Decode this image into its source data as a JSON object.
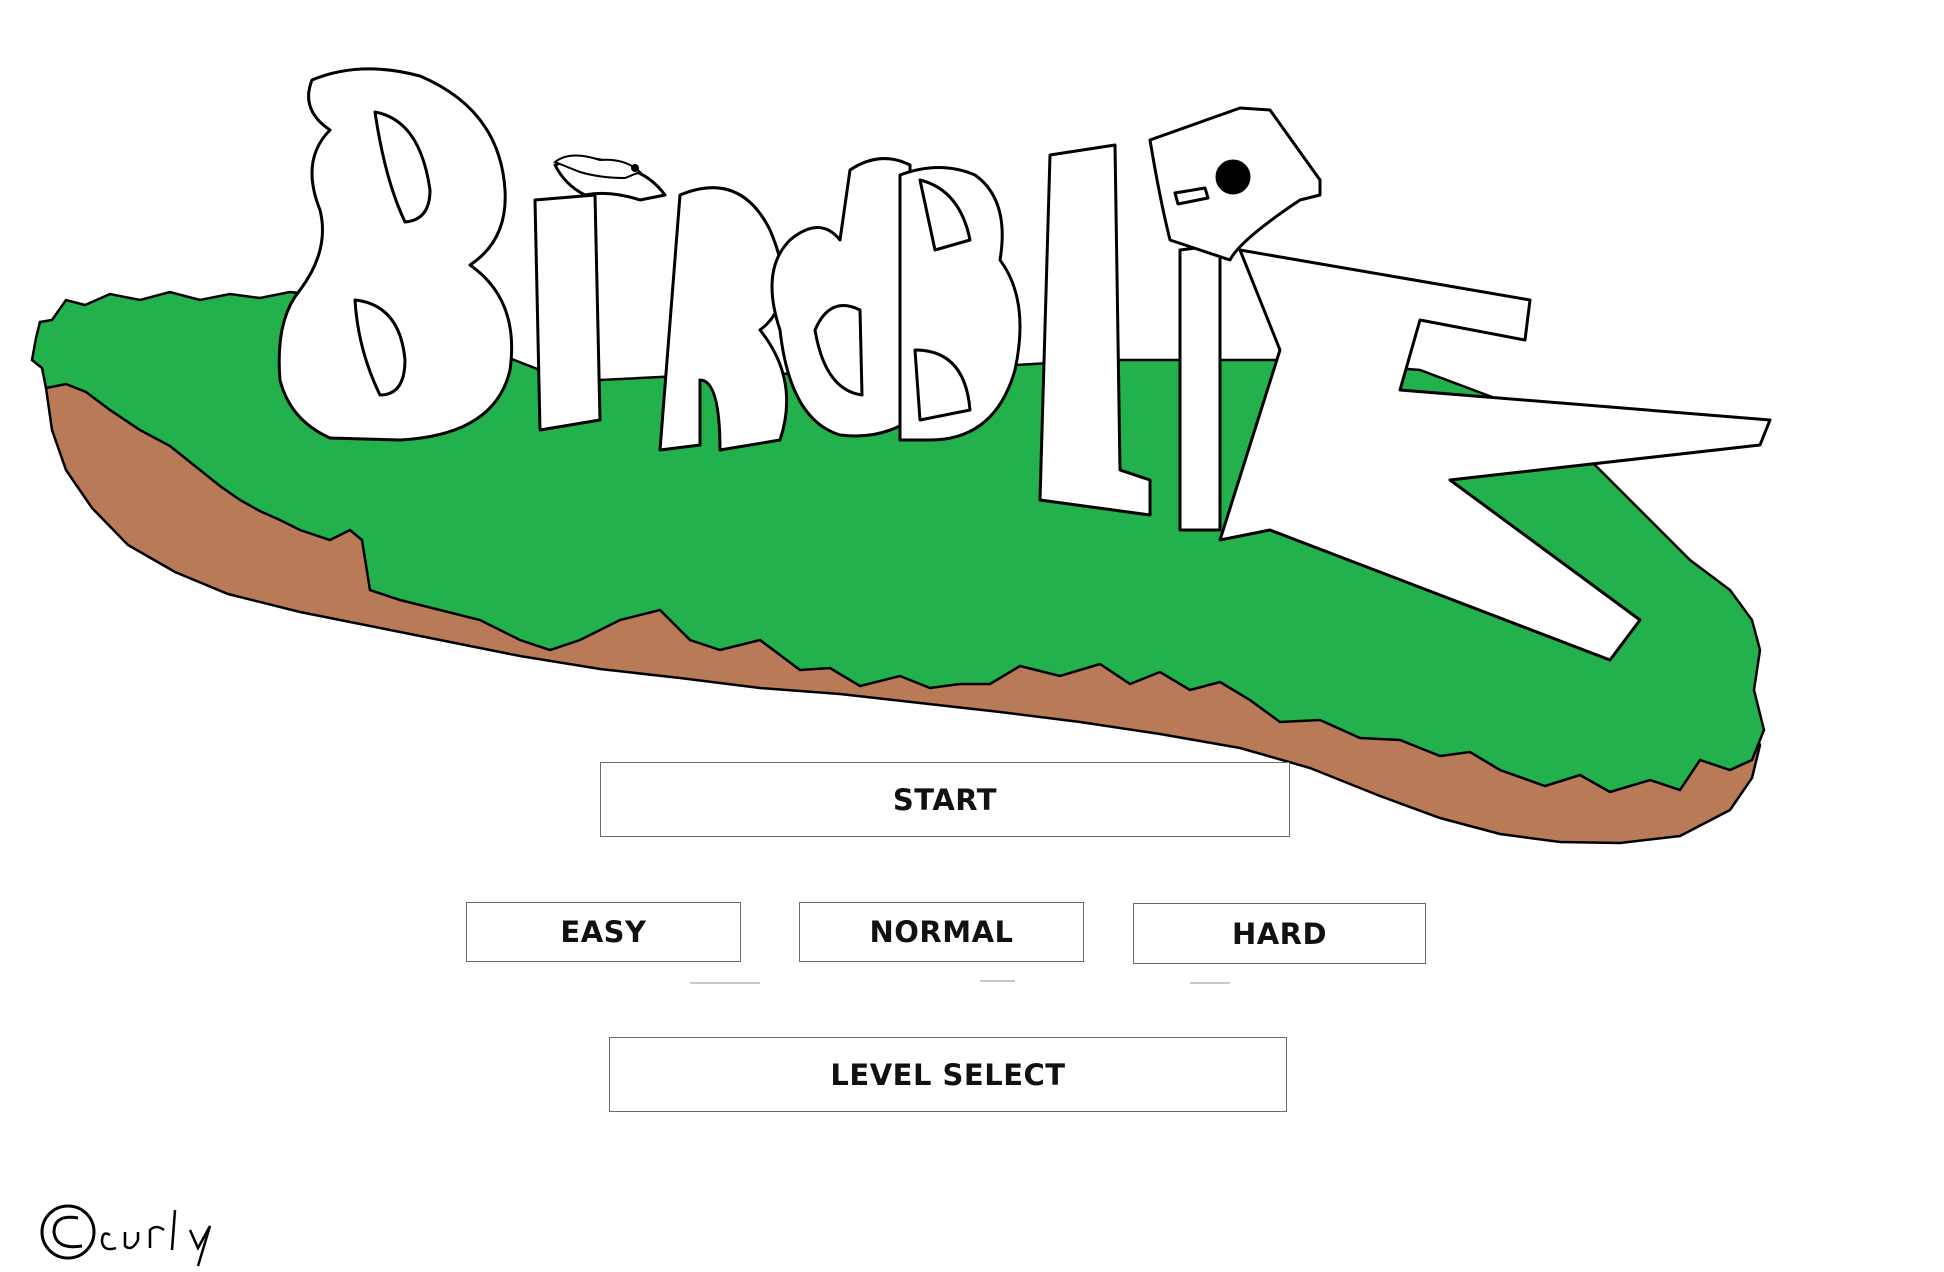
{
  "menu": {
    "start": "START",
    "easy": "EASY",
    "normal": "NORMAL",
    "hard": "HARD",
    "level_select": "LEVEL SELECT"
  },
  "logo": {
    "title_text": "BirdBlitz"
  },
  "footer": {
    "signature_text": "©curly"
  },
  "colors": {
    "grass": "#22b14c",
    "dirt": "#b97a57",
    "outline": "#000000",
    "background": "#ffffff"
  }
}
